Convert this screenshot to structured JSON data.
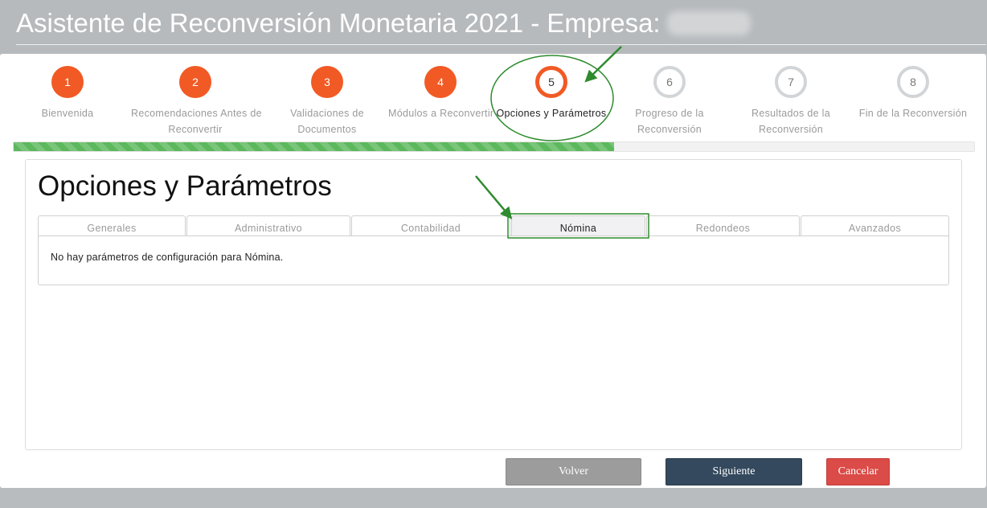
{
  "window": {
    "title": "Asistente de Reconversión Monetaria 2021 - Empresa:"
  },
  "wizard": {
    "steps": [
      {
        "number": "1",
        "label_lines": [
          "Bienvenida",
          ""
        ],
        "state": "done"
      },
      {
        "number": "2",
        "label_lines": [
          "Recomendaciones Antes de",
          "Reconvertir"
        ],
        "state": "done"
      },
      {
        "number": "3",
        "label_lines": [
          "Validaciones de",
          "Documentos"
        ],
        "state": "done"
      },
      {
        "number": "4",
        "label_lines": [
          "Módulos a Reconvertir",
          ""
        ],
        "state": "done"
      },
      {
        "number": "5",
        "label_lines": [
          "Opciones y Parámetros",
          ""
        ],
        "state": "current"
      },
      {
        "number": "6",
        "label_lines": [
          "Progreso de la",
          "Reconversión"
        ],
        "state": "pending"
      },
      {
        "number": "7",
        "label_lines": [
          "Resultados de la",
          "Reconversión"
        ],
        "state": "pending"
      },
      {
        "number": "8",
        "label_lines": [
          "Fin de la Reconversión",
          ""
        ],
        "state": "pending"
      }
    ],
    "progress_fraction": 0.625
  },
  "section": {
    "title": "Opciones y Parámetros"
  },
  "tabs": [
    {
      "label": "Generales",
      "active": false
    },
    {
      "label": "Administrativo",
      "active": false
    },
    {
      "label": "Contabilidad",
      "active": false
    },
    {
      "label": "Nómina",
      "active": true
    },
    {
      "label": "Redondeos",
      "active": false
    },
    {
      "label": "Avanzados",
      "active": false
    }
  ],
  "tab_content": {
    "message": "No hay parámetros de configuración para Nómina."
  },
  "buttons": {
    "back": "Volver",
    "next": "Siguiente",
    "cancel": "Cancelar"
  },
  "colors": {
    "step_done": "#f15a24",
    "step_pending": "#d2d5d8",
    "progress": "#5cb85c",
    "next_button": "#34495e",
    "cancel_button": "#db4b47",
    "annotation": "#2e8b2e"
  }
}
